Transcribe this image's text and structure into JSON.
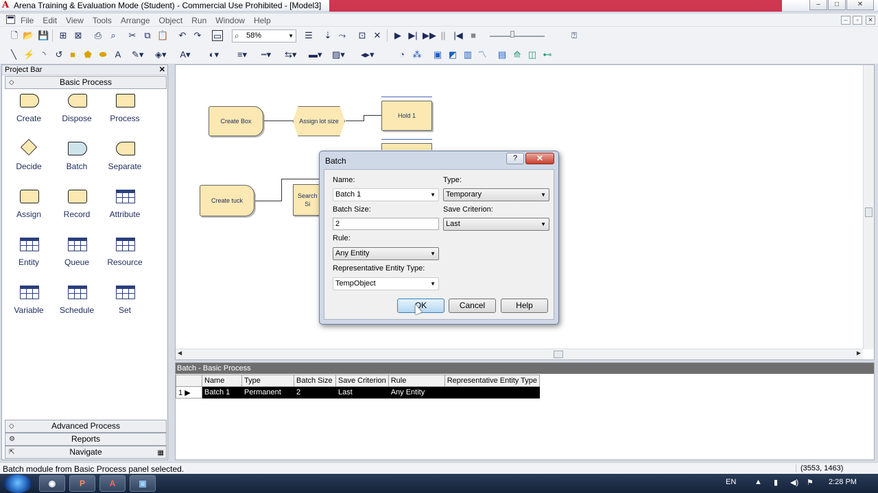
{
  "window": {
    "title": "Arena Training & Evaluation Mode (Student) - Commercial Use Prohibited - [Model3]"
  },
  "menu": [
    "File",
    "Edit",
    "View",
    "Tools",
    "Arrange",
    "Object",
    "Run",
    "Window",
    "Help"
  ],
  "toolbar": {
    "zoom": "58%"
  },
  "project_bar": {
    "title": "Project Bar",
    "panels": {
      "basic": "Basic Process",
      "advanced": "Advanced Process",
      "reports": "Reports",
      "navigate": "Navigate"
    },
    "modules": [
      "Create",
      "Dispose",
      "Process",
      "Decide",
      "Batch",
      "Separate",
      "Assign",
      "Record",
      "Attribute",
      "Entity",
      "Queue",
      "Resource",
      "Variable",
      "Schedule",
      "Set"
    ]
  },
  "model": {
    "blocks": {
      "create_box": "Create Box",
      "assign_lot": "Assign lot size",
      "hold": "Hold 1",
      "create_tuck": "Create tuck",
      "search": "Search\nSi"
    }
  },
  "dialog": {
    "title": "Batch",
    "name_label": "Name:",
    "name_value": "Batch 1",
    "type_label": "Type:",
    "type_value": "Temporary",
    "batch_size_label": "Batch Size:",
    "batch_size_value": "2",
    "save_criterion_label": "Save Criterion:",
    "save_criterion_value": "Last",
    "rule_label": "Rule:",
    "rule_value": "Any Entity",
    "rep_type_label": "Representative Entity Type:",
    "rep_type_value": "TempObject",
    "ok": "OK",
    "cancel": "Cancel",
    "help": "Help"
  },
  "spreadsheet": {
    "title": "Batch - Basic Process",
    "columns": [
      "",
      "Name",
      "Type",
      "Batch Size",
      "Save Criterion",
      "Rule",
      "Representative Entity Type"
    ],
    "rows": [
      [
        "1",
        "Batch 1",
        "Permanent",
        "2",
        "Last",
        "Any Entity",
        ""
      ]
    ]
  },
  "status": {
    "message": "Batch module from Basic Process panel selected.",
    "coords": "(3553, 1463)"
  },
  "taskbar": {
    "lang": "EN",
    "time": "2:28 PM"
  }
}
